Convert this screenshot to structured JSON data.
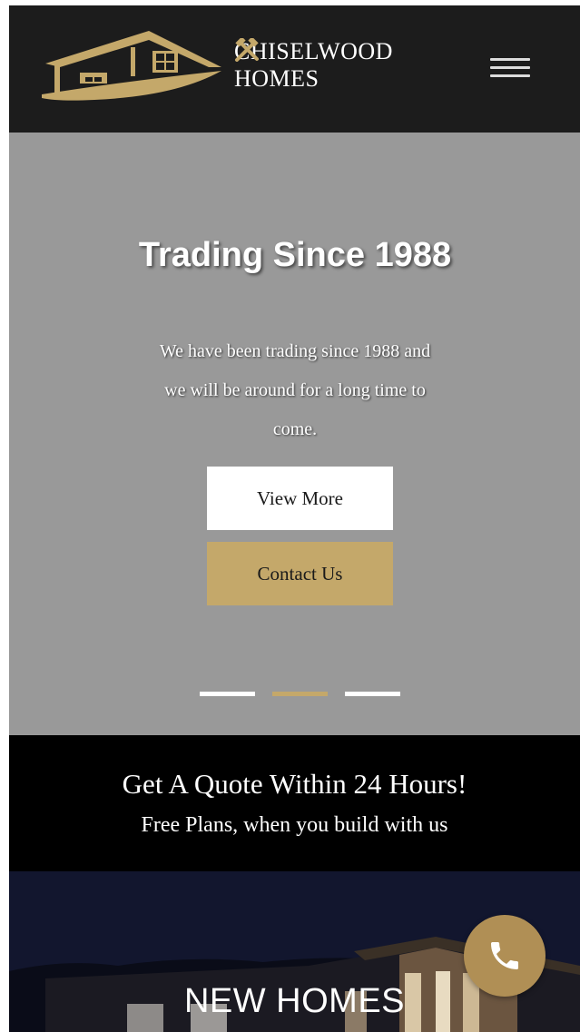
{
  "colors": {
    "header_bg": "#1c1c1c",
    "gold": "#c4a86a",
    "hero_bg": "#999999",
    "quote_bg": "#000000"
  },
  "header": {
    "logo_alt": "Chiselwood Homes logo",
    "brand_line1": "CHISELWOOD",
    "brand_line2": "HOMES",
    "menu_icon": "hamburger-menu-icon"
  },
  "hero": {
    "title": "Trading Since 1988",
    "text": "We have been trading since 1988 and we will be around for a long time to come.",
    "view_more_label": "View More",
    "contact_label": "Contact Us",
    "slides": 3,
    "active_slide": 2
  },
  "quote": {
    "title": "Get A Quote Within 24 Hours!",
    "subtitle": "Free Plans, when you build with us"
  },
  "new_homes": {
    "title": "NEW HOMES"
  },
  "call_button": {
    "icon": "phone-icon"
  }
}
